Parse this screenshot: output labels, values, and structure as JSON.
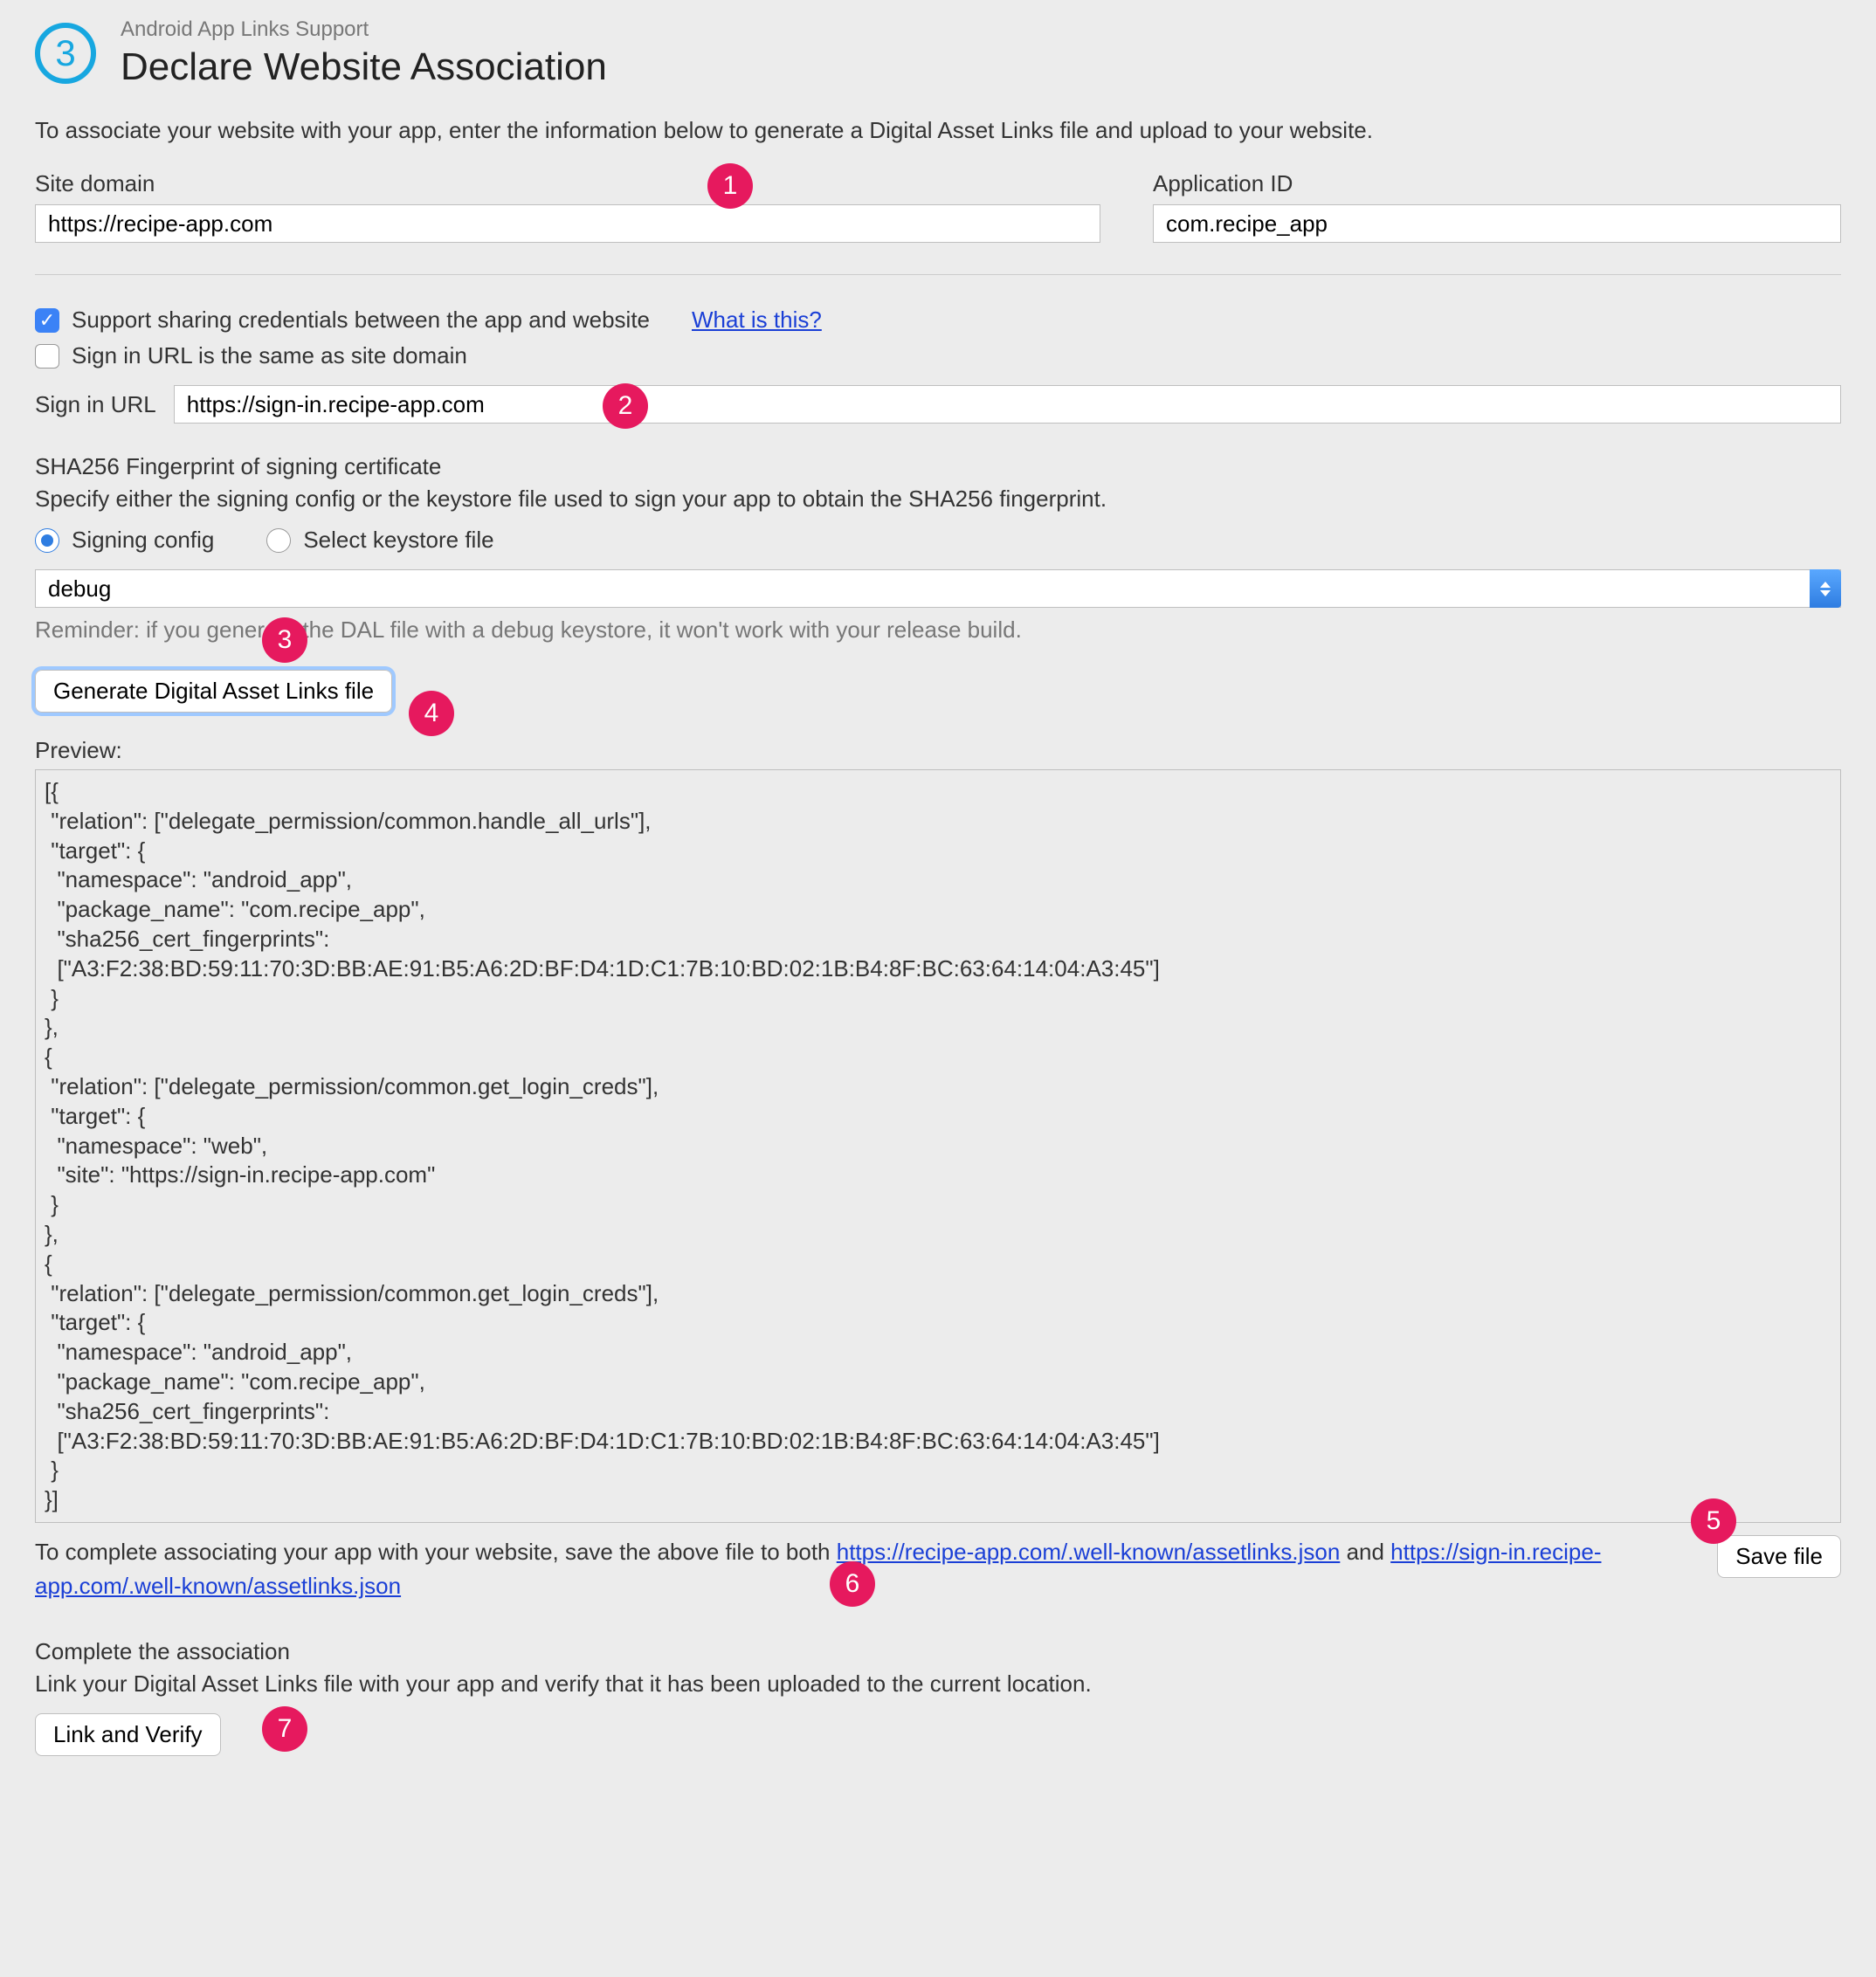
{
  "header": {
    "step_number": "3",
    "breadcrumb": "Android App Links Support",
    "title": "Declare Website Association"
  },
  "intro": "To associate your website with your app, enter the information below to generate a Digital Asset Links file and upload to your website.",
  "fields": {
    "site_domain_label": "Site domain",
    "site_domain_value": "https://recipe-app.com",
    "application_id_label": "Application ID",
    "application_id_value": "com.recipe_app"
  },
  "credentials": {
    "support_label": "Support sharing credentials between the app and website",
    "what_is_this": "What is this?",
    "same_as_domain_label": "Sign in URL is the same as site domain",
    "sign_in_url_label": "Sign in URL",
    "sign_in_url_value": "https://sign-in.recipe-app.com"
  },
  "sha": {
    "title": "SHA256 Fingerprint of signing certificate",
    "subtitle": "Specify either the signing config or the keystore file used to sign your app to obtain the SHA256 fingerprint.",
    "radio_signing_config": "Signing config",
    "radio_keystore": "Select keystore file",
    "config_value": "debug",
    "reminder": "Reminder: if you generate the DAL file with a debug keystore, it won't work with your release build."
  },
  "buttons": {
    "generate": "Generate Digital Asset Links file",
    "save_file": "Save file",
    "link_verify": "Link and Verify"
  },
  "preview": {
    "label": "Preview:",
    "content": "[{\n \"relation\": [\"delegate_permission/common.handle_all_urls\"],\n \"target\": {\n  \"namespace\": \"android_app\",\n  \"package_name\": \"com.recipe_app\",\n  \"sha256_cert_fingerprints\":\n  [\"A3:F2:38:BD:59:11:70:3D:BB:AE:91:B5:A6:2D:BF:D4:1D:C1:7B:10:BD:02:1B:B4:8F:BC:63:64:14:04:A3:45\"]\n }\n},\n{\n \"relation\": [\"delegate_permission/common.get_login_creds\"],\n \"target\": {\n  \"namespace\": \"web\",\n  \"site\": \"https://sign-in.recipe-app.com\"\n }\n},\n{\n \"relation\": [\"delegate_permission/common.get_login_creds\"],\n \"target\": {\n  \"namespace\": \"android_app\",\n  \"package_name\": \"com.recipe_app\",\n  \"sha256_cert_fingerprints\":\n  [\"A3:F2:38:BD:59:11:70:3D:BB:AE:91:B5:A6:2D:BF:D4:1D:C1:7B:10:BD:02:1B:B4:8F:BC:63:64:14:04:A3:45\"]\n }\n}]"
  },
  "save_instruction": {
    "prefix": "To complete associating your app with your website, save the above file to both ",
    "link1": "https://recipe-app.com/.well-known/assetlinks.json",
    "middle": " and ",
    "link2": "https://sign-in.recipe-app.com/.well-known/assetlinks.json"
  },
  "complete": {
    "title": "Complete the association",
    "subtitle": "Link your Digital Asset Links file with your app and verify that it has been uploaded to the current location."
  },
  "callouts": {
    "c1": "1",
    "c2": "2",
    "c3": "3",
    "c4": "4",
    "c5": "5",
    "c6": "6",
    "c7": "7"
  }
}
